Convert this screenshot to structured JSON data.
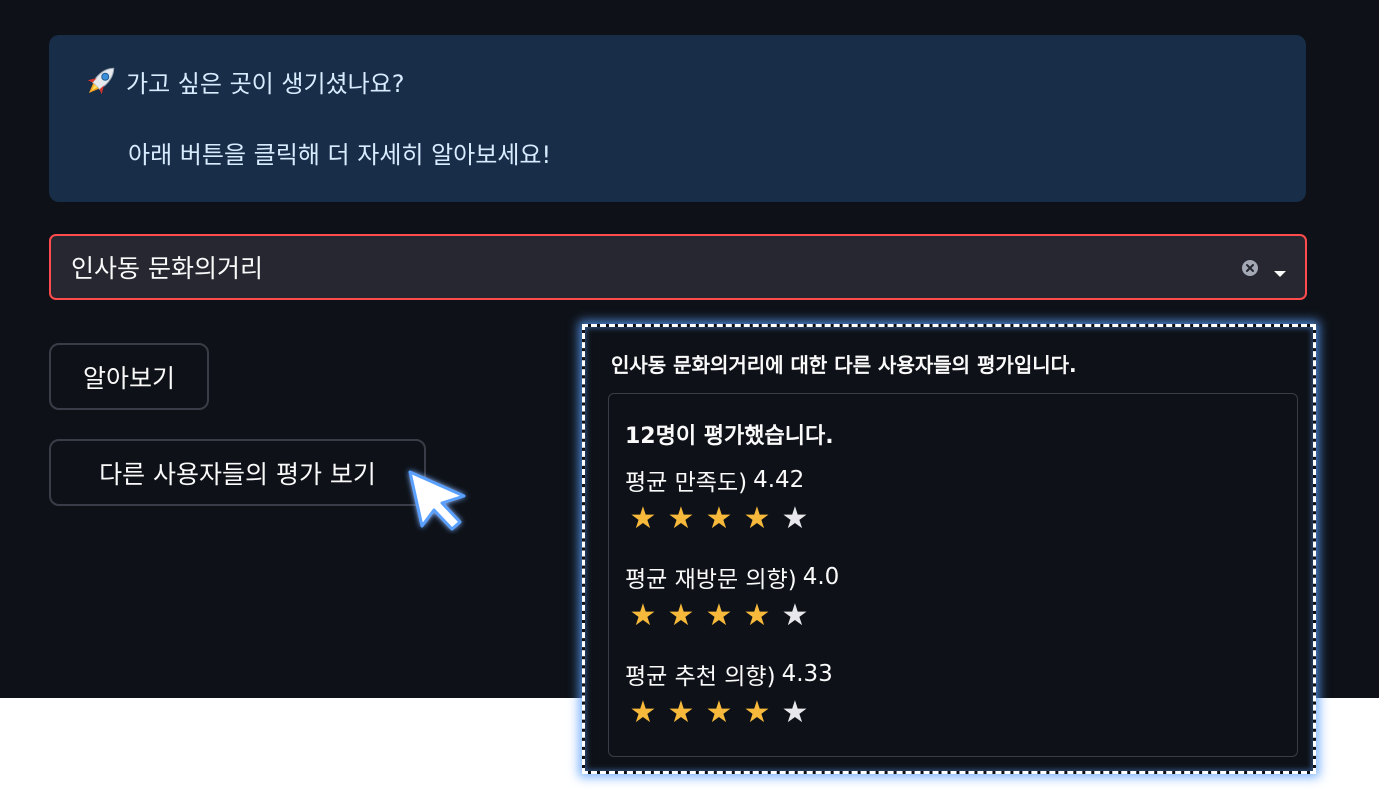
{
  "info": {
    "line1": "가고 싶은 곳이 생기셨나요?",
    "line2": "아래 버튼을 클릭해 더 자세히 알아보세요!",
    "icon": "rocket-icon"
  },
  "place_select": {
    "value": "인사동 문화의거리",
    "icons": [
      "clear-icon",
      "chevron-down-icon"
    ]
  },
  "buttons": {
    "learn_more": "알아보기",
    "view_reviews": "다른 사용자들의 평가 보기"
  },
  "reviews": {
    "title": "인사동 문화의거리에 대한 다른 사용자들의 평가입니다.",
    "count_text": "12명이 평가했습니다.",
    "metrics": [
      {
        "label": "평균 만족도)",
        "value": "4.42",
        "stars_filled": 4,
        "stars_total": 5
      },
      {
        "label": "평균 재방문 의향)",
        "value": "4.0",
        "stars_filled": 4,
        "stars_total": 5
      },
      {
        "label": "평균 추천 의향)",
        "value": "4.33",
        "stars_filled": 4,
        "stars_total": 5
      }
    ]
  },
  "colors": {
    "app_bg": "#0e1117",
    "info_bg": "#172d48",
    "select_border": "#ff4b4b",
    "star_filled": "#f6b93b",
    "star_empty": "#e8e8ec",
    "highlight_glow": "#5aa0ff"
  }
}
